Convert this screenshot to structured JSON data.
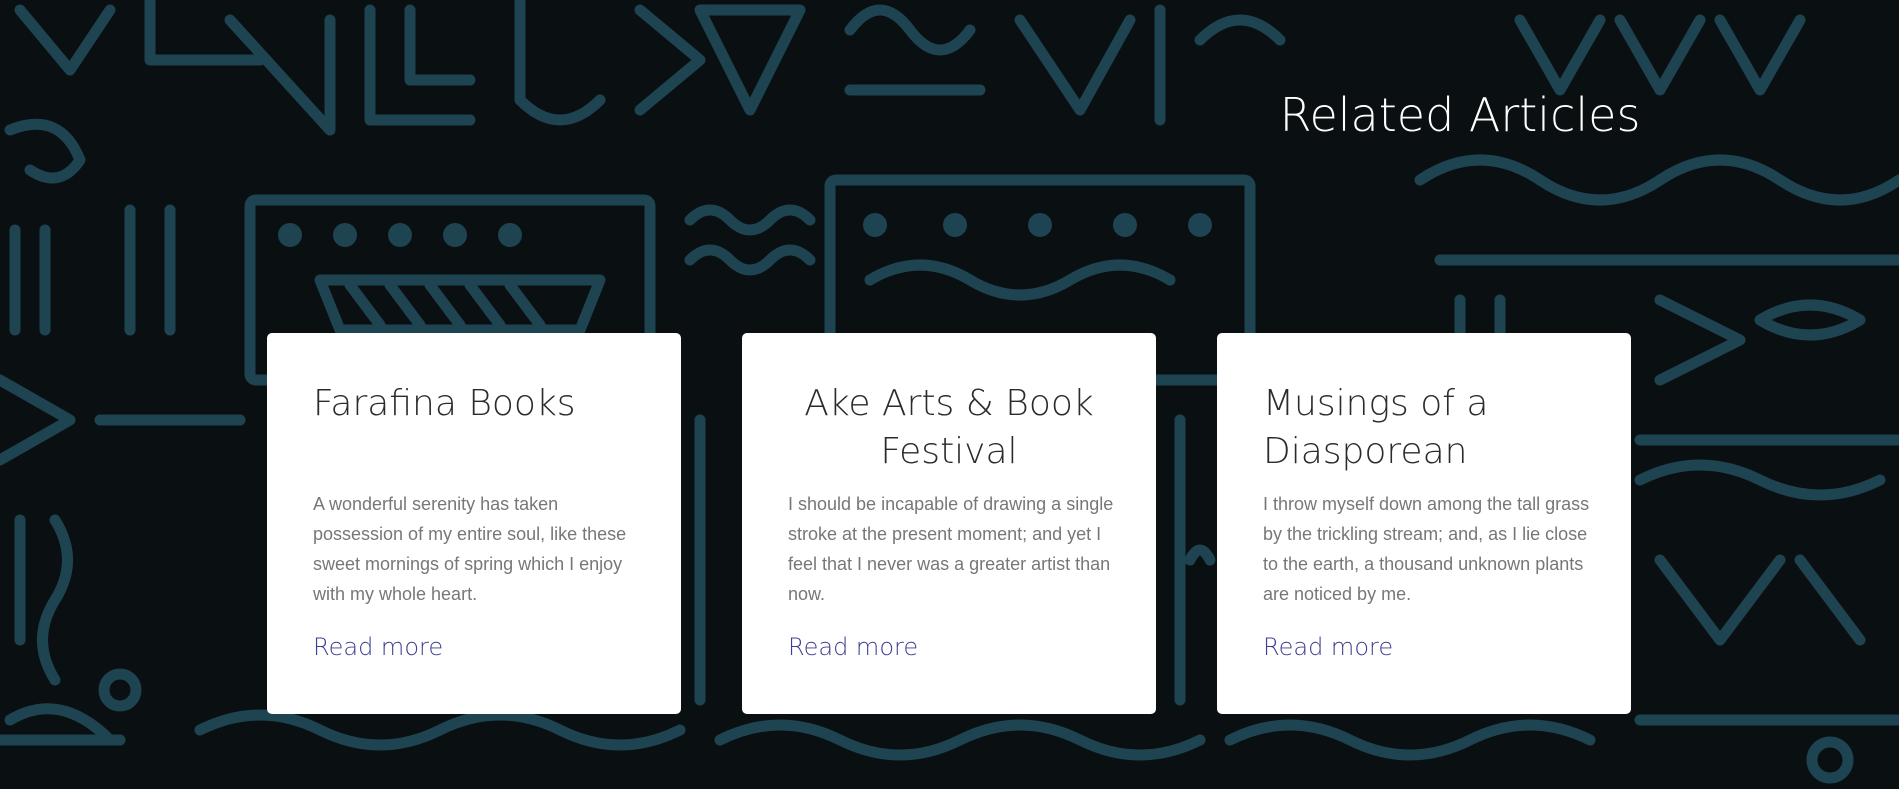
{
  "section": {
    "title": "Related Articles"
  },
  "articles": [
    {
      "title": "Farafina Books",
      "excerpt": "A wonderful serenity has taken possession of my entire soul, like these sweet mornings of spring which I enjoy with my whole heart.",
      "link_label": "Read more"
    },
    {
      "title": "Ake Arts & Book Festival",
      "excerpt": "I should be incapable of drawing a single stroke at the present moment; and yet I feel that I never was a greater artist than now.",
      "link_label": "Read more"
    },
    {
      "title": "Musings of a Diasporean",
      "excerpt": "I throw myself down among the tall grass by the trickling stream; and, as I lie close to the earth, a thousand unknown plants are noticed by me.",
      "link_label": "Read more"
    }
  ],
  "colors": {
    "background": "#0a0f12",
    "pattern": "#1e4452",
    "card": "#ffffff",
    "heading_text": "#2b2b2b",
    "body_text": "#777777",
    "link": "#3b3f8f",
    "section_title": "#ffffff"
  }
}
